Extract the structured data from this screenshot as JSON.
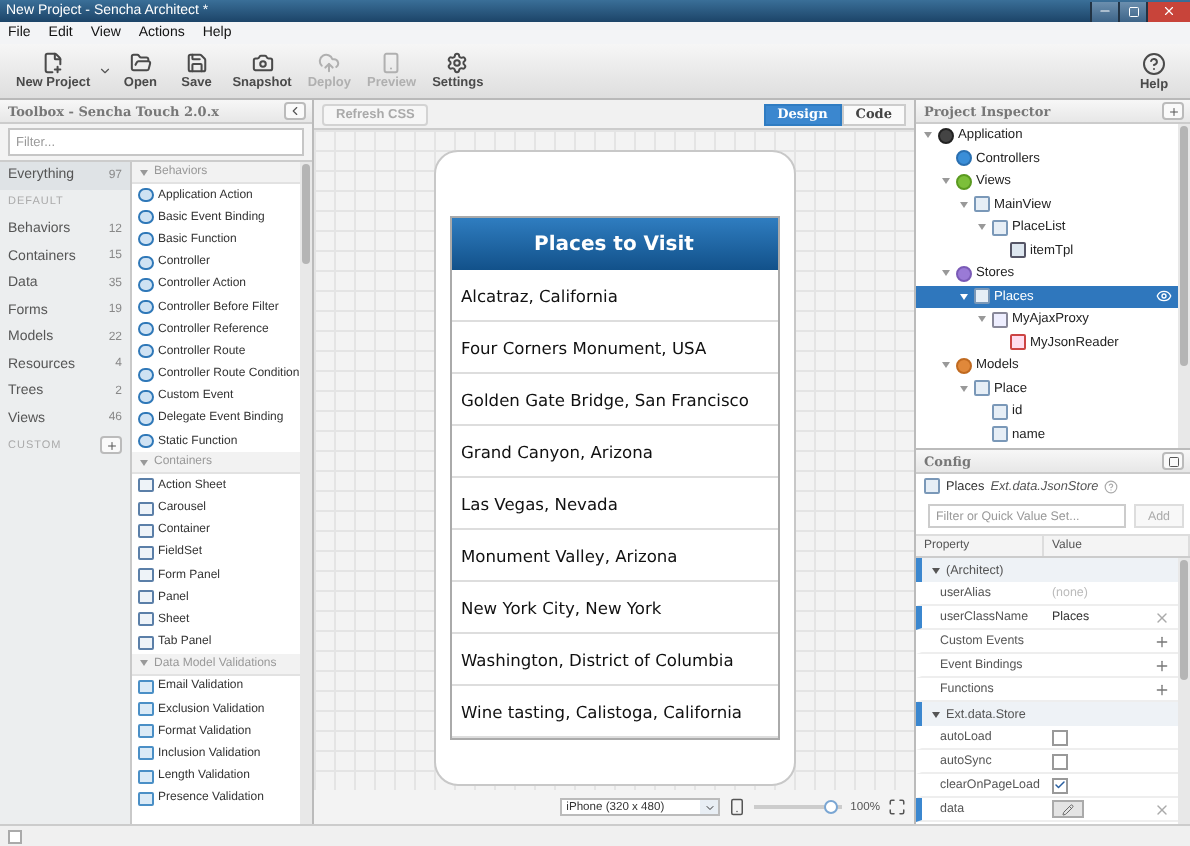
{
  "window": {
    "title": "New Project - Sencha Architect *"
  },
  "menu": [
    "File",
    "Edit",
    "View",
    "Actions",
    "Help"
  ],
  "toolbar": [
    {
      "kind": "new",
      "label": "New Project",
      "disabled": false,
      "dropdown": true
    },
    {
      "kind": "open",
      "label": "Open",
      "disabled": false,
      "dropdown": false
    },
    {
      "kind": "save",
      "label": "Save",
      "disabled": false,
      "dropdown": false
    },
    {
      "kind": "snapshot",
      "label": "Snapshot",
      "disabled": false,
      "dropdown": false
    },
    {
      "kind": "deploy",
      "label": "Deploy",
      "disabled": true,
      "dropdown": false
    },
    {
      "kind": "preview",
      "label": "Preview",
      "disabled": true,
      "dropdown": false
    },
    {
      "kind": "settings",
      "label": "Settings",
      "disabled": false,
      "dropdown": false
    }
  ],
  "help_button": "Help",
  "toolbox": {
    "title": "Toolbox - Sencha Touch 2.0.x",
    "filter_placeholder": "Filter...",
    "categories": [
      {
        "kind": "category",
        "label": "Everything",
        "count": "97",
        "selected": true
      },
      {
        "kind": "section",
        "label": "DEFAULT",
        "selected": false
      },
      {
        "kind": "category",
        "label": "Behaviors",
        "count": "12",
        "selected": false
      },
      {
        "kind": "category",
        "label": "Containers",
        "count": "15",
        "selected": false
      },
      {
        "kind": "category",
        "label": "Data",
        "count": "35",
        "selected": false
      },
      {
        "kind": "category",
        "label": "Forms",
        "count": "19",
        "selected": false
      },
      {
        "kind": "category",
        "label": "Models",
        "count": "22",
        "selected": false
      },
      {
        "kind": "category",
        "label": "Resources",
        "count": "4",
        "selected": false
      },
      {
        "kind": "category",
        "label": "Trees",
        "count": "2",
        "selected": false
      },
      {
        "kind": "category",
        "label": "Views",
        "count": "46",
        "selected": false
      },
      {
        "kind": "section",
        "label": "CUSTOM",
        "selected": false
      }
    ],
    "groups": [
      {
        "kind": "behavior",
        "title": "Behaviors",
        "items": [
          "Application Action",
          "Basic Event Binding",
          "Basic Function",
          "Controller",
          "Controller Action",
          "Controller Before Filter",
          "Controller Reference",
          "Controller Route",
          "Controller Route Condition",
          "Custom Event",
          "Delegate Event Binding",
          "Static Function"
        ]
      },
      {
        "kind": "container",
        "title": "Containers",
        "items": [
          "Action Sheet",
          "Carousel",
          "Container",
          "FieldSet",
          "Form Panel",
          "Panel",
          "Sheet",
          "Tab Panel"
        ]
      },
      {
        "kind": "validation",
        "title": "Data Model Validations",
        "items": [
          "Email Validation",
          "Exclusion Validation",
          "Format Validation",
          "Inclusion Validation",
          "Length Validation",
          "Presence Validation"
        ]
      }
    ]
  },
  "canvas": {
    "refresh_button": "Refresh CSS",
    "view_tabs": [
      {
        "label": "Design",
        "selected": true
      },
      {
        "label": "Code",
        "selected": false
      }
    ],
    "phone": {
      "title": "Places to Visit",
      "items": [
        "Alcatraz, California",
        "Four Corners Monument, USA",
        "Golden Gate Bridge, San Francisco",
        "Grand Canyon, Arizona",
        "Las Vegas, Nevada",
        "Monument Valley, Arizona",
        "New York City, New York",
        "Washington, District of Columbia",
        "Wine tasting, Calistoga, California"
      ]
    },
    "device": "iPhone (320 x 480)",
    "zoom": {
      "level": 0.95,
      "reading": "100%"
    }
  },
  "inspector": {
    "title": "Project Inspector",
    "tree": [
      {
        "kind": "app",
        "label": "Application",
        "selected": false,
        "expanded": true,
        "children": [
          {
            "kind": "controller",
            "label": "Controllers",
            "selected": false
          },
          {
            "kind": "view",
            "label": "Views",
            "selected": false,
            "expanded": true,
            "children": [
              {
                "kind": "component",
                "label": "MainView",
                "selected": false,
                "expanded": true,
                "children": [
                  {
                    "kind": "component",
                    "label": "PlaceList",
                    "selected": false,
                    "expanded": true,
                    "children": [
                      {
                        "kind": "template",
                        "label": "itemTpl",
                        "selected": false
                      }
                    ]
                  }
                ]
              }
            ]
          },
          {
            "kind": "store",
            "label": "Stores",
            "selected": false,
            "expanded": true,
            "children": [
              {
                "kind": "component",
                "label": "Places",
                "selected": true,
                "expanded": true,
                "children": [
                  {
                    "kind": "proxy",
                    "label": "MyAjaxProxy",
                    "selected": false,
                    "expanded": true,
                    "children": [
                      {
                        "kind": "reader",
                        "label": "MyJsonReader",
                        "selected": false
                      }
                    ]
                  }
                ]
              }
            ]
          },
          {
            "kind": "model",
            "label": "Models",
            "selected": false,
            "expanded": true,
            "children": [
              {
                "kind": "component",
                "label": "Place",
                "selected": false,
                "expanded": true,
                "children": [
                  {
                    "kind": "field",
                    "label": "id",
                    "selected": false
                  },
                  {
                    "kind": "field",
                    "label": "name",
                    "selected": false
                  }
                ]
              }
            ]
          }
        ]
      }
    ]
  },
  "config": {
    "title": "Config",
    "subject": "Places",
    "subject_class": "Ext.data.JsonStore",
    "filter_placeholder": "Filter or Quick Value Set...",
    "add_button": "Add",
    "columns": [
      "Property",
      "Value"
    ],
    "groups": [
      {
        "title": "(Architect)",
        "rows": [
          {
            "kind": "text",
            "name": "userAlias",
            "value": "(none)",
            "empty": true,
            "modified": false
          },
          {
            "kind": "text",
            "name": "userClassName",
            "value": "Places",
            "empty": false,
            "modified": true
          },
          {
            "kind": "action",
            "name": "Custom Events",
            "modified": false
          },
          {
            "kind": "action",
            "name": "Event Bindings",
            "modified": false
          },
          {
            "kind": "action",
            "name": "Functions",
            "modified": false
          }
        ]
      },
      {
        "title": "Ext.data.Store",
        "rows": [
          {
            "kind": "checkbox",
            "name": "autoLoad",
            "checked": false,
            "modified": false
          },
          {
            "kind": "checkbox",
            "name": "autoSync",
            "checked": false,
            "modified": false
          },
          {
            "kind": "checkbox",
            "name": "clearOnPageLoad",
            "checked": true,
            "modified": false
          },
          {
            "kind": "editor",
            "name": "data",
            "modified": true
          }
        ]
      }
    ]
  }
}
